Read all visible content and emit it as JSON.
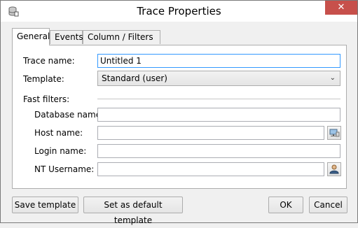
{
  "window": {
    "title": "Trace Properties",
    "close_glyph": "✕"
  },
  "tabs": [
    {
      "label": "General"
    },
    {
      "label": "Events"
    },
    {
      "label": "Column / Filters"
    }
  ],
  "general": {
    "trace_name_label": "Trace name:",
    "trace_name_value": "Untitled 1",
    "template_label": "Template:",
    "template_value": "Standard (user)",
    "fast_filters_label": "Fast filters:",
    "database_name_label": "Database name:",
    "database_name_value": "",
    "host_name_label": "Host name:",
    "host_name_value": "",
    "login_name_label": "Login name:",
    "login_name_value": "",
    "nt_username_label": "NT Username:",
    "nt_username_value": ""
  },
  "buttons": {
    "save_template": "Save template",
    "set_default_template": "Set as default template",
    "ok": "OK",
    "cancel": "Cancel"
  },
  "colors": {
    "focus": "#3399ff",
    "close": "#c7504b"
  }
}
